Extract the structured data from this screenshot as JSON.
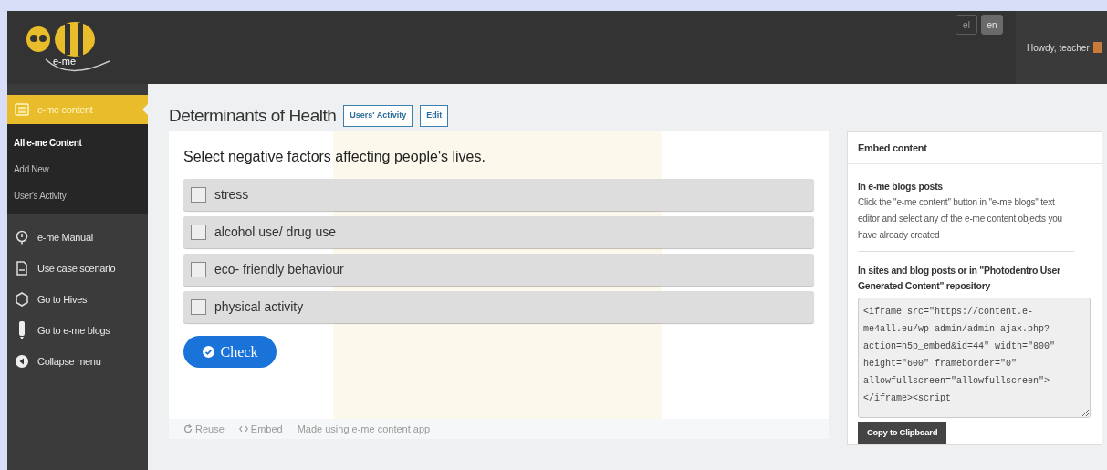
{
  "header": {
    "logo_text": "e-me",
    "languages": [
      {
        "label": "el",
        "selected": false
      },
      {
        "label": "en",
        "selected": true
      }
    ],
    "greeting": "Howdy, teacher"
  },
  "sidebar": {
    "items": [
      {
        "label": "e-me content",
        "selected": true,
        "children": [
          {
            "label": "All e-me Content",
            "selected": true
          },
          {
            "label": "Add New",
            "selected": false
          },
          {
            "label": "User's Activity",
            "selected": false
          }
        ]
      },
      {
        "label": "e-me Manual",
        "selected": false
      },
      {
        "label": "Use case scenario",
        "selected": false
      },
      {
        "label": "Go to Hives",
        "selected": false
      },
      {
        "label": "Go to e-me blogs",
        "selected": false
      },
      {
        "label": "Collapse menu",
        "selected": false
      }
    ]
  },
  "page": {
    "title": "Determinants of Health",
    "buttons": [
      "Users' Activity",
      "Edit"
    ]
  },
  "quiz": {
    "question": "Select negative factors affecting people's lives.",
    "options": [
      {
        "label": "stress",
        "checked": false
      },
      {
        "label": "alcohol use/ drug use",
        "checked": false
      },
      {
        "label": "eco- friendly behaviour",
        "checked": false
      },
      {
        "label": "physical activity",
        "checked": false
      }
    ],
    "check_button": "Check",
    "footer": [
      "Reuse",
      "Embed",
      "Made using e-me content app"
    ]
  },
  "embed_panel": {
    "title": "Embed content",
    "sections": [
      {
        "heading": "In e-me blogs posts",
        "text": "Click the \"e-me content\" button in \"e-me blogs\" text editor and select any of the e-me content objects you have already created"
      },
      {
        "heading": "In sites and blog posts or in \"Photodentro User Generated Content\" repository",
        "code": "<iframe src=\"https://content.e-me4all.eu/wp-admin/admin-ajax.php?action=h5p_embed&id=44\" width=\"800\" height=\"600\" frameborder=\"0\" allowfullscreen=\"allowfullscreen\"></iframe><script"
      }
    ],
    "copy_button": "Copy to Clipboard"
  }
}
